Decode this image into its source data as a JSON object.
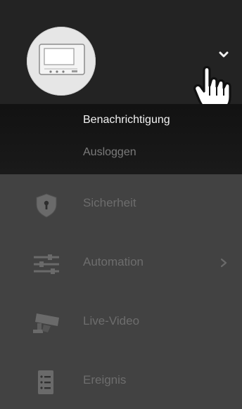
{
  "header": {
    "avatar_icon": "intercom-monitor-icon",
    "dropdown_icon": "chevron-down-icon",
    "cursor_icon": "hand-pointer-cursor"
  },
  "submenu": {
    "items": [
      {
        "label": "Benachrichtigung",
        "state": "active"
      },
      {
        "label": "Ausloggen",
        "state": "inactive"
      }
    ]
  },
  "nav": {
    "items": [
      {
        "label": "Sicherheit",
        "icon": "shield-lock-icon"
      },
      {
        "label": "Automation",
        "icon": "sliders-icon",
        "has_submenu": true
      },
      {
        "label": "Live-Video",
        "icon": "security-camera-icon"
      },
      {
        "label": "Ereignis",
        "icon": "event-list-icon"
      }
    ]
  },
  "colors": {
    "header_bg": "#232323",
    "submenu_bg": "#151515",
    "nav_bg": "#424242",
    "active_text": "#f2f2f2",
    "muted_text": "#6d6d6d"
  }
}
